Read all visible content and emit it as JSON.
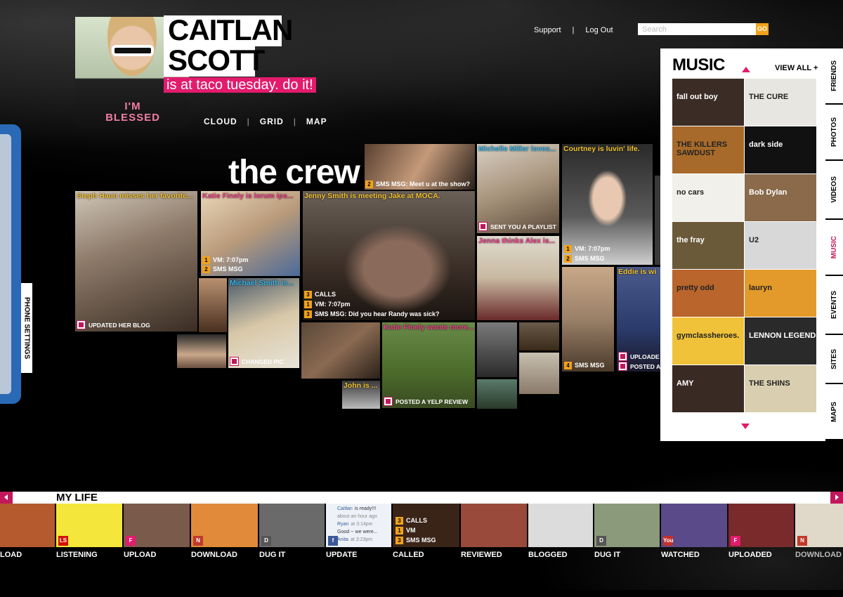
{
  "profile": {
    "first_name": "CAITLAN",
    "last_name": "SCOTT",
    "status": "is at taco tuesday. do it!",
    "shirt_text": "I'M BLESSED"
  },
  "view_nav": [
    "CLOUD",
    "GRID",
    "MAP"
  ],
  "top_nav": {
    "support": "Support",
    "logout": "Log Out"
  },
  "search": {
    "placeholder": "Search",
    "go": "GO"
  },
  "crew": {
    "title": "the crew",
    "tiles": [
      {
        "caption": "Steph Haun misses her favorite...",
        "tag": "UPDATED HER BLOG"
      },
      {
        "caption": "Katie Finely is lorum ips...",
        "stats": [
          {
            "n": "1",
            "text": "VM: 7:07pm"
          },
          {
            "n": "2",
            "text": "SMS MSG"
          }
        ]
      },
      {
        "caption": "Jenny Smith is meeting Jake at MOCA.",
        "stats": [
          {
            "n": "3",
            "text": "CALLS"
          },
          {
            "n": "1",
            "text": "VM: 7:07pm"
          },
          {
            "n": "3",
            "text": "SMS MSG: Did you hear Randy was sick?"
          }
        ]
      },
      {
        "caption": "",
        "stats": [
          {
            "n": "2",
            "text": "SMS MSG: Meet u at the show?"
          }
        ]
      },
      {
        "caption": "Michelle Miller loves...",
        "tag": "SENT YOU A PLAYLIST"
      },
      {
        "caption": "Courtney is luvin' life.",
        "stats": [
          {
            "n": "1",
            "text": "VM: 7:07pm"
          },
          {
            "n": "2",
            "text": "SMS MSG"
          }
        ]
      },
      {
        "caption": "Michael Smith is...",
        "tag": "CHANGED PIC"
      },
      {
        "caption": "Katie Finely wants more...",
        "tag": "POSTED A YELP REVIEW"
      },
      {
        "caption": "Jenna thinks Alex is..."
      },
      {
        "caption": "Eddie is wi",
        "tags": [
          "UPLOADE",
          "POSTED A"
        ]
      },
      {
        "caption": "John is ..."
      },
      {
        "caption": "",
        "stats": [
          {
            "n": "4",
            "text": "SMS MSG"
          }
        ]
      }
    ]
  },
  "music": {
    "title": "MUSIC",
    "view_all": "VIEW ALL",
    "albums": [
      {
        "name": "fall out boy",
        "color": "#3b2d25"
      },
      {
        "name": "THE CURE",
        "color": "#e8e6e0"
      },
      {
        "name": "THE KILLERS SAWDUST",
        "color": "#a86a2a"
      },
      {
        "name": "dark side",
        "color": "#111111"
      },
      {
        "name": "no cars",
        "color": "#f2f0ea"
      },
      {
        "name": "Bob Dylan",
        "color": "#8a6a4a"
      },
      {
        "name": "the fray",
        "color": "#6a5a3a"
      },
      {
        "name": "U2",
        "color": "#d8d8d8"
      },
      {
        "name": "pretty odd",
        "color": "#b9652b"
      },
      {
        "name": "lauryn",
        "color": "#e49a2a"
      },
      {
        "name": "gymclassheroes.",
        "color": "#f0c23a"
      },
      {
        "name": "LENNON LEGEND",
        "color": "#2a2a2a"
      },
      {
        "name": "AMY",
        "color": "#3a2a24"
      },
      {
        "name": "THE SHINS",
        "color": "#d9cfb0"
      }
    ]
  },
  "side_tabs": [
    {
      "label": "FRIENDS",
      "active": false
    },
    {
      "label": "PHOTOS",
      "active": false
    },
    {
      "label": "VIDEOS",
      "active": false
    },
    {
      "label": "MUSIC",
      "active": true
    },
    {
      "label": "EVENTS",
      "active": false
    },
    {
      "label": "SITES",
      "active": false
    },
    {
      "label": "MAPS",
      "active": false
    }
  ],
  "phone_settings": "PHONE SETTINGS",
  "my_life": {
    "title": "MY LIFE",
    "items": [
      {
        "label": "LOAD",
        "color": "#b45a2e",
        "badge": ""
      },
      {
        "label": "LISTENING",
        "color": "#f4e63a",
        "badge": "LS"
      },
      {
        "label": "UPLOAD",
        "color": "#7a5a4a",
        "badge": "F"
      },
      {
        "label": "DOWNLOAD",
        "color": "#e08a3a",
        "badge": "N"
      },
      {
        "label": "DUG IT",
        "color": "#6a6a6a",
        "badge": "D"
      },
      {
        "label": "UPDATE",
        "color": "#eef2f8",
        "badge": "f"
      },
      {
        "label": "CALLED",
        "color": "#3a2418",
        "badge": ""
      },
      {
        "label": "REVIEWED",
        "color": "#9a4a3a",
        "badge": ""
      },
      {
        "label": "BLOGGED",
        "color": "#dcdcdc",
        "badge": ""
      },
      {
        "label": "DUG IT",
        "color": "#8a9a7a",
        "badge": "D"
      },
      {
        "label": "WATCHED",
        "color": "#5a4a8a",
        "badge": "You"
      },
      {
        "label": "UPLOADED",
        "color": "#7a2a2a",
        "badge": "F"
      },
      {
        "label": "DOWNLOAD",
        "color": "#e0d8c8",
        "badge": "N"
      }
    ],
    "update_post": {
      "name": "Caitlan",
      "text": "is ready!!!",
      "time": "about an hour ago",
      "reply_name": "Ryan",
      "reply_time": "at 3:14pm",
      "reply_text": "Good -- we were...",
      "reply2_name": "Anita",
      "reply2_time": "at 3:23pm"
    },
    "called_stats": [
      {
        "n": "3",
        "text": "CALLS"
      },
      {
        "n": "1",
        "text": "VM"
      },
      {
        "n": "3",
        "text": "SMS MSG"
      }
    ]
  }
}
